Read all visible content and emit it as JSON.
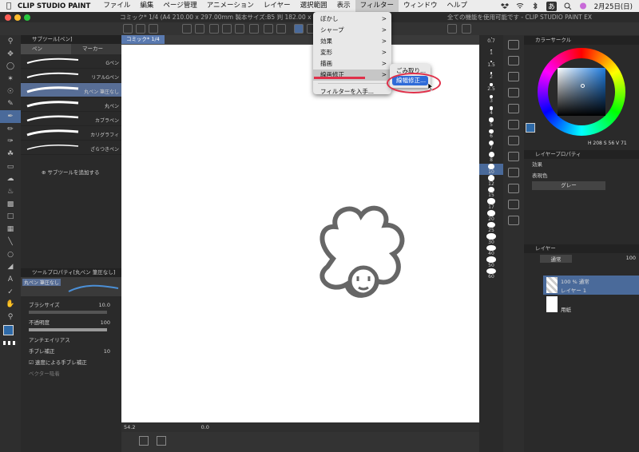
{
  "menubar": {
    "app": "CLIP STUDIO PAINT",
    "items": [
      "ファイル",
      "編集",
      "ページ管理",
      "アニメーション",
      "レイヤー",
      "選択範囲",
      "表示",
      "フィルター",
      "ウィンドウ",
      "ヘルプ"
    ],
    "active": "フィルター",
    "input_indicator": "あ",
    "date": "2月25日(日)"
  },
  "window": {
    "title": "コミック* 1/4 (A4 210.00 x 297.00mm 製本サイズ:B5 判 182.00 x 257.00mm",
    "title_tail": "全ての機能を使用可能です - CLIP STUDIO PAINT EX"
  },
  "filter_menu": {
    "items": [
      {
        "label": "ぼかし",
        "submenu": true
      },
      {
        "label": "シャープ",
        "submenu": true
      },
      {
        "label": "効果",
        "submenu": true
      },
      {
        "label": "変形",
        "submenu": true
      },
      {
        "label": "描画",
        "submenu": true
      },
      {
        "label": "線画修正",
        "submenu": true
      },
      {
        "label": "フィルターを入手...",
        "submenu": false
      }
    ],
    "highlighted": "線画修正",
    "arrow": ">"
  },
  "line_correction_submenu": {
    "items": [
      "ごみ取り...",
      "線幅修正..."
    ],
    "selected": "線幅修正..."
  },
  "subtool_panel": {
    "title": "サブツール[ペン]",
    "tabs": [
      "ペン",
      "マーカー"
    ],
    "brushes": [
      "Gペン",
      "リアルGペン",
      "丸ペン 筆圧なし",
      "丸ペン",
      "カブラペン",
      "カリグラフィ",
      "ざらつきペン"
    ],
    "selected": "丸ペン 筆圧なし",
    "add_label": "サブツールを追加する"
  },
  "tool_property": {
    "title": "ツールプロパティ[丸ペン 筆圧なし]",
    "preset": "丸ペン 筆圧なし",
    "brush_size_label": "ブラシサイズ",
    "brush_size": "10.0",
    "opacity_label": "不透明度",
    "opacity": "100",
    "antialias_label": "アンチエイリアス",
    "stabilization_label": "手ブレ補正",
    "stabilization": "10",
    "speed_stab_label": "速度による手ブレ補正",
    "vector_snap_label": "ベクター吸着"
  },
  "canvas": {
    "tab": "コミック* 1/4",
    "zoom": "54.2",
    "angle": "0.0"
  },
  "brush_sizes": [
    "0.7",
    "1",
    "1.5",
    "2",
    "2.5",
    "3",
    "4",
    "5",
    "6",
    "7",
    "8",
    "10",
    "12",
    "15",
    "17",
    "20",
    "25",
    "30",
    "40",
    "50",
    "60"
  ],
  "selected_size": "10",
  "color_wheel": {
    "title": "カラーサークル",
    "h": "208",
    "s": "56",
    "v": "71",
    "main_color": "#2e6aa8"
  },
  "layer_property": {
    "title": "レイヤープロパティ",
    "effect_label": "効果",
    "expression_label": "表現色",
    "expression_value": "グレー"
  },
  "layer_panel": {
    "title": "レイヤー",
    "blend": "通常",
    "opacity": "100",
    "layers": [
      {
        "line1": "100 % 通常",
        "line2": "レイヤー 1",
        "selected": true
      },
      {
        "line1": "",
        "line2": "用紙",
        "selected": false
      }
    ]
  },
  "colors": {
    "accent": "#4a6a9a",
    "highlight": "#2f6bd8",
    "annotation": "#e0304a"
  }
}
